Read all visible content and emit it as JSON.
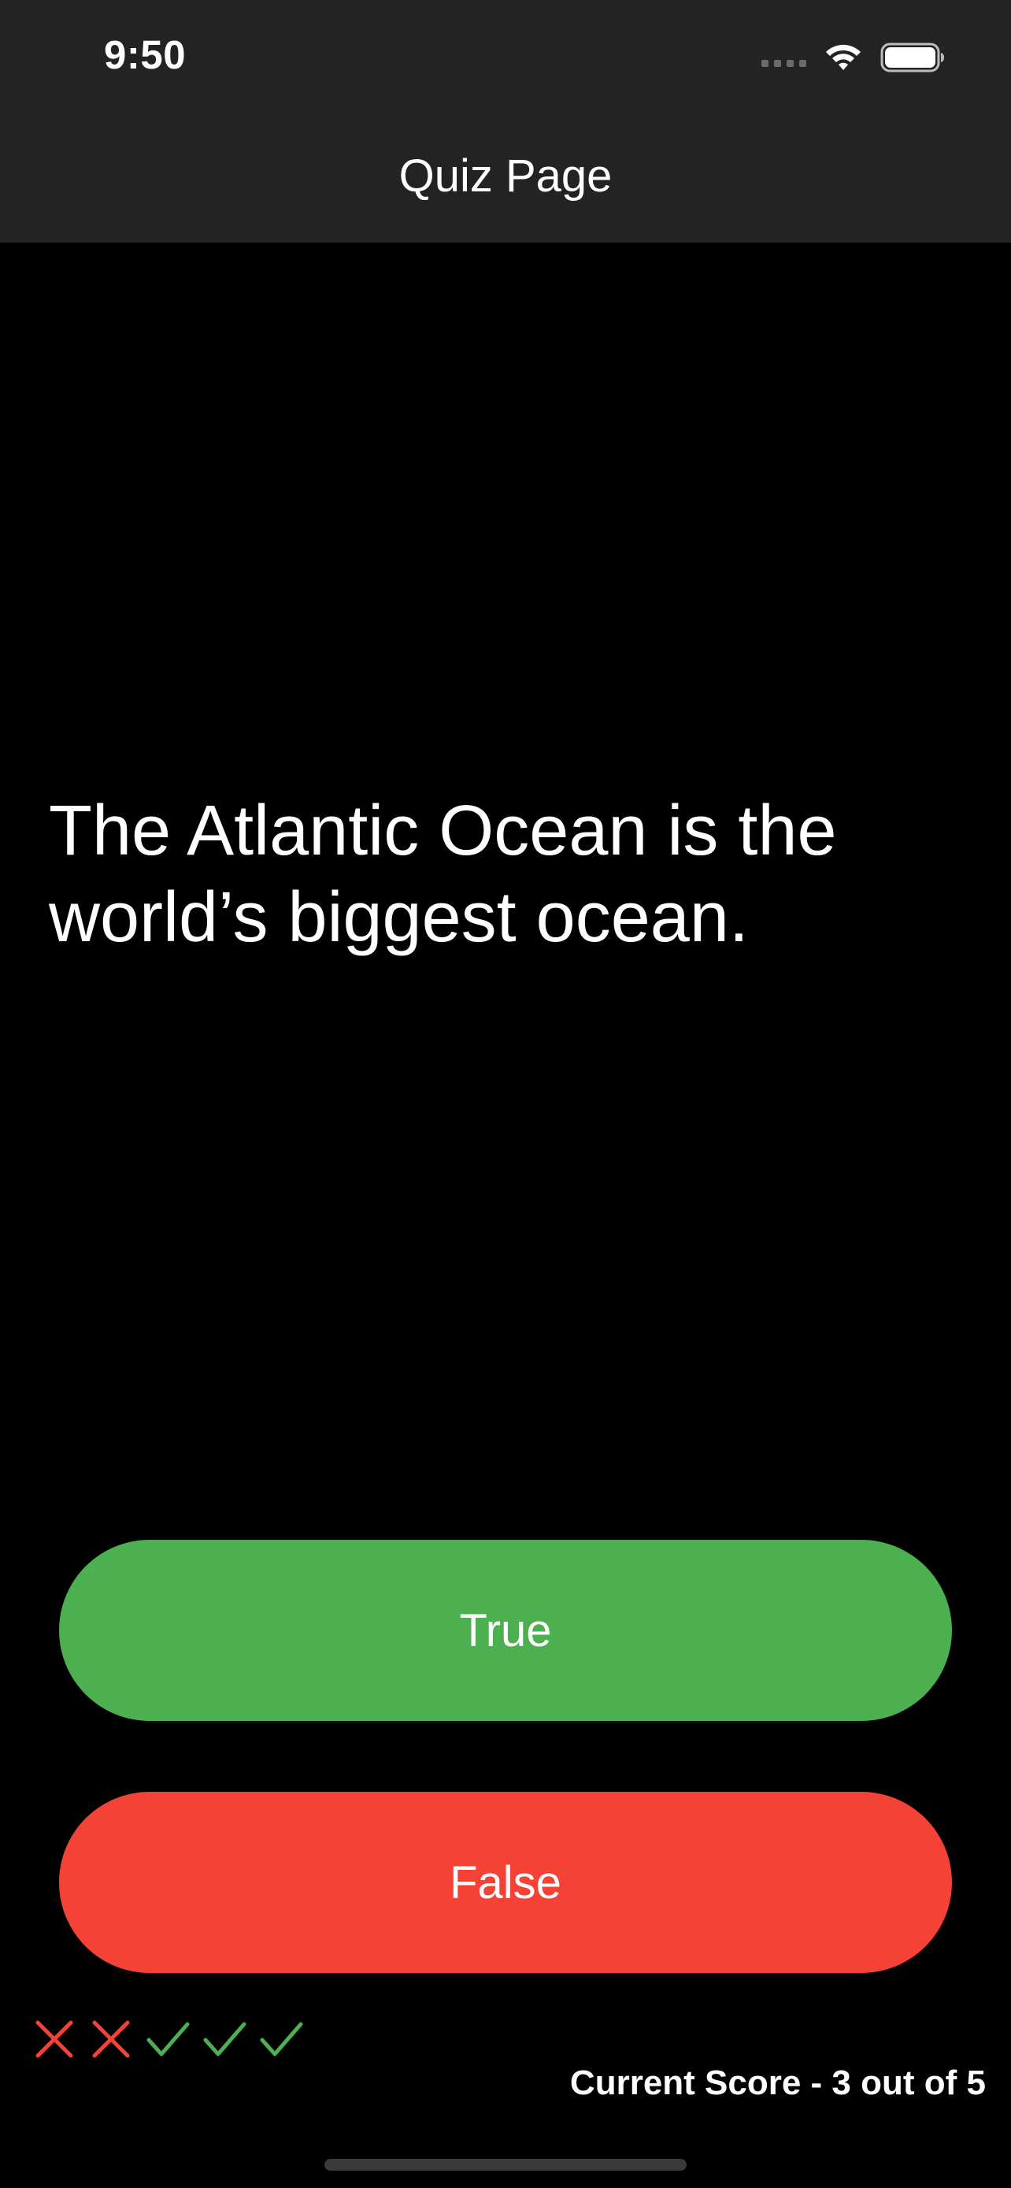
{
  "status_bar": {
    "time": "9:50"
  },
  "header": {
    "title": "Quiz Page"
  },
  "question": {
    "text": "The Atlantic Ocean is the world’s biggest ocean."
  },
  "buttons": {
    "true_label": "True",
    "false_label": "False"
  },
  "score_keeper": {
    "marks": [
      {
        "type": "cross-icon",
        "color": "#f44336"
      },
      {
        "type": "cross-icon",
        "color": "#f44336"
      },
      {
        "type": "check-icon",
        "color": "#4caf50"
      },
      {
        "type": "check-icon",
        "color": "#4caf50"
      },
      {
        "type": "check-icon",
        "color": "#4caf50"
      }
    ]
  },
  "score": {
    "text": "Current Score - 3 out of 5"
  },
  "colors": {
    "header_bg": "#232323",
    "true_button": "#4caf50",
    "false_button": "#f44336",
    "background": "#000000"
  }
}
